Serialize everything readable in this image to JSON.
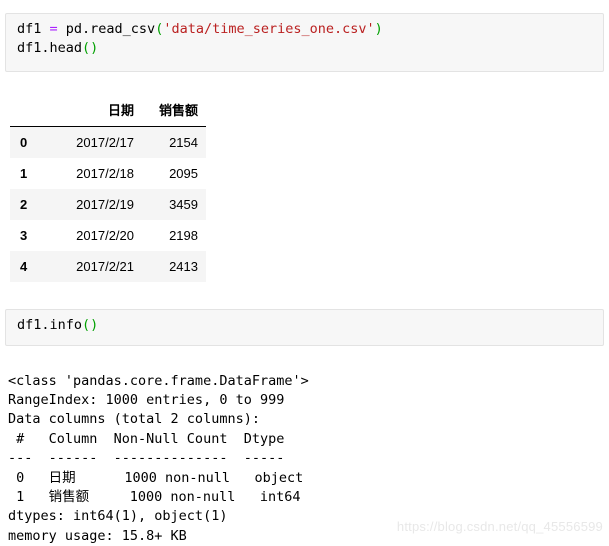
{
  "notebook": {
    "cells": [
      {
        "type": "code",
        "id": "cell-1",
        "lines": [
          {
            "tokens": [
              {
                "text": "df1 ",
                "kind": "name"
              },
              {
                "text": "=",
                "kind": "op"
              },
              {
                "text": " pd.read_csv",
                "kind": "name"
              },
              {
                "text": "(",
                "kind": "punct"
              },
              {
                "text": "'data/time_series_one.csv'",
                "kind": "str"
              },
              {
                "text": ")",
                "kind": "punct"
              }
            ]
          },
          {
            "tokens": [
              {
                "text": "df1.head",
                "kind": "name"
              },
              {
                "text": "()",
                "kind": "punct"
              }
            ]
          }
        ]
      },
      {
        "type": "code",
        "id": "cell-2",
        "lines": [
          {
            "tokens": [
              {
                "text": "df1.info",
                "kind": "name"
              },
              {
                "text": "()",
                "kind": "punct"
              }
            ]
          }
        ]
      }
    ]
  },
  "dataframe_output": {
    "index_header": "",
    "columns": [
      "日期",
      "销售额"
    ],
    "index": [
      "0",
      "1",
      "2",
      "3",
      "4"
    ],
    "rows": [
      {
        "index": "0",
        "date": "2017/2/17",
        "sales": "2154"
      },
      {
        "index": "1",
        "date": "2017/2/18",
        "sales": "2095"
      },
      {
        "index": "2",
        "date": "2017/2/19",
        "sales": "3459"
      },
      {
        "index": "3",
        "date": "2017/2/20",
        "sales": "2198"
      },
      {
        "index": "4",
        "date": "2017/2/21",
        "sales": "2413"
      }
    ]
  },
  "info_output": {
    "lines": [
      "<class 'pandas.core.frame.DataFrame'>",
      "RangeIndex: 1000 entries, 0 to 999",
      "Data columns (total 2 columns):",
      " #   Column  Non-Null Count  Dtype",
      "---  ------  --------------  -----",
      " 0   日期      1000 non-null   object",
      " 1   销售额     1000 non-null   int64",
      "dtypes: int64(1), object(1)",
      "memory usage: 15.8+ KB"
    ]
  },
  "watermark": {
    "text": "https://blog.csdn.net/qq_45556599"
  },
  "colors": {
    "cell_background": "#f7f7f7",
    "cell_border": "#e3e3e3",
    "string_token": "#ba2121",
    "operator_token": "#aa22ff",
    "punct_token": "#00a000",
    "table_stripe": "#f5f5f5",
    "watermark": "#e8e8e8",
    "text": "#000000"
  }
}
